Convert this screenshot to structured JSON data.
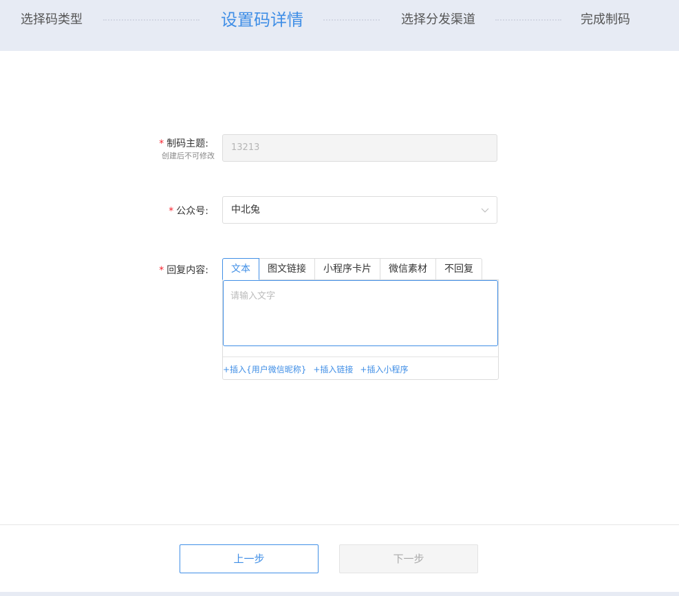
{
  "steps": [
    {
      "label": "选择码类型",
      "active": false
    },
    {
      "label": "设置码详情",
      "active": true
    },
    {
      "label": "选择分发渠道",
      "active": false
    },
    {
      "label": "完成制码",
      "active": false
    }
  ],
  "form": {
    "required_mark": "*",
    "subject": {
      "label": "制码主题:",
      "sublabel": "创建后不可修改",
      "value": "13213"
    },
    "account": {
      "label": "公众号:",
      "value": "中北兔"
    },
    "reply": {
      "label": "回复内容:",
      "tabs": [
        "文本",
        "图文链接",
        "小程序卡片",
        "微信素材",
        "不回复"
      ],
      "active_tab": "文本",
      "placeholder": "请输入文字",
      "inserts": [
        "+插入{用户微信昵称}",
        "+插入链接",
        "+插入小程序"
      ]
    }
  },
  "footer": {
    "prev_label": "上一步",
    "next_label": "下一步"
  },
  "colors": {
    "accent": "#3f8ee6",
    "header_bg": "#e7ebf4",
    "required": "#f5222d"
  }
}
